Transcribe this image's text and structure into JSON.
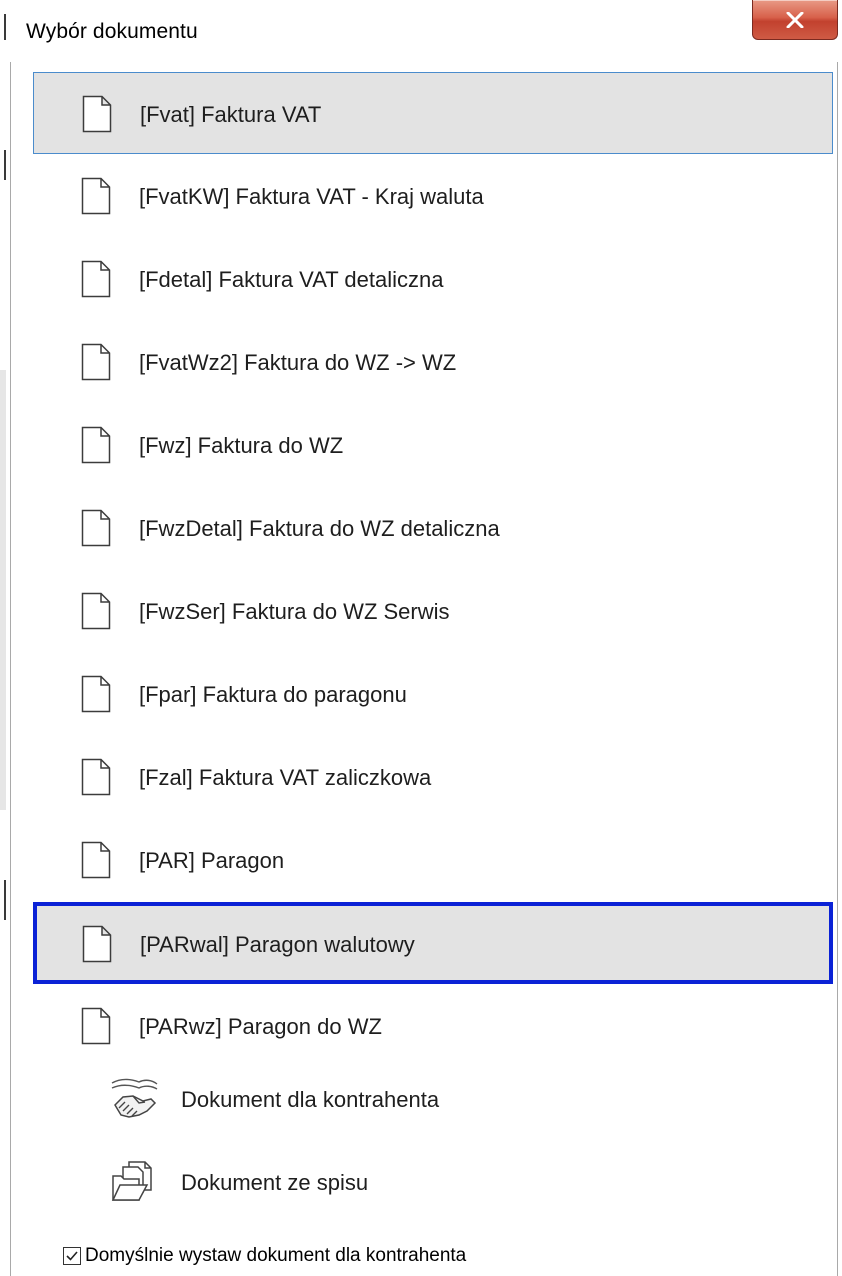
{
  "window": {
    "title": "Wybór dokumentu",
    "close_icon": "close-x-icon",
    "close_color": "#c7432f"
  },
  "documents": [
    {
      "label": "[Fvat] Faktura VAT",
      "icon": "document-icon",
      "state": "selected"
    },
    {
      "label": "[FvatKW] Faktura VAT - Kraj waluta",
      "icon": "document-icon",
      "state": "normal"
    },
    {
      "label": "[Fdetal] Faktura VAT detaliczna",
      "icon": "document-icon",
      "state": "normal"
    },
    {
      "label": "[FvatWz2] Faktura do WZ -> WZ",
      "icon": "document-icon",
      "state": "normal"
    },
    {
      "label": "[Fwz] Faktura do WZ",
      "icon": "document-icon",
      "state": "normal"
    },
    {
      "label": "[FwzDetal] Faktura do WZ detaliczna",
      "icon": "document-icon",
      "state": "normal"
    },
    {
      "label": "[FwzSer] Faktura do WZ Serwis",
      "icon": "document-icon",
      "state": "normal"
    },
    {
      "label": "[Fpar] Faktura do paragonu",
      "icon": "document-icon",
      "state": "normal"
    },
    {
      "label": "[Fzal] Faktura VAT zaliczkowa",
      "icon": "document-icon",
      "state": "normal"
    },
    {
      "label": "[PAR] Paragon",
      "icon": "document-icon",
      "state": "normal"
    },
    {
      "label": "[PARwal] Paragon walutowy",
      "icon": "document-icon",
      "state": "focused"
    },
    {
      "label": "[PARwz] Paragon do WZ",
      "icon": "document-icon",
      "state": "normal"
    }
  ],
  "extra_options": [
    {
      "label": "Dokument dla kontrahenta",
      "icon": "handshake-icon"
    },
    {
      "label": "Dokument ze spisu",
      "icon": "open-folder-icon"
    }
  ],
  "footer": {
    "checkbox_checked": true,
    "checkbox_label": "Domyślnie wystaw dokument dla kontrahenta"
  },
  "colors": {
    "selection_border": "#4b8ccc",
    "focus_border": "#0b22d6",
    "selection_background": "#e3e3e3"
  }
}
